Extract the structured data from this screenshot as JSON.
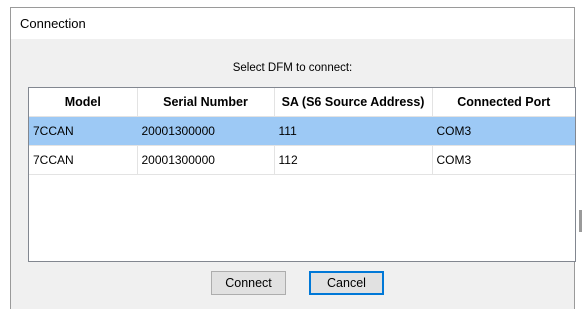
{
  "window": {
    "title": "Connection"
  },
  "prompt": "Select DFM to connect:",
  "table": {
    "columns": [
      "Model",
      "Serial Number",
      "SA (S6 Source Address)",
      "Connected Port"
    ],
    "rows": [
      {
        "model": "7CCAN",
        "serial": "20001300000",
        "sa": "111",
        "port": "COM3",
        "selected": true
      },
      {
        "model": "7CCAN",
        "serial": "20001300000",
        "sa": "112",
        "port": "COM3",
        "selected": false
      }
    ]
  },
  "buttons": {
    "connect_label": "Connect",
    "cancel_label": "Cancel"
  },
  "colors": {
    "selection": "#9dc9f5",
    "focus_border": "#0078d7"
  }
}
